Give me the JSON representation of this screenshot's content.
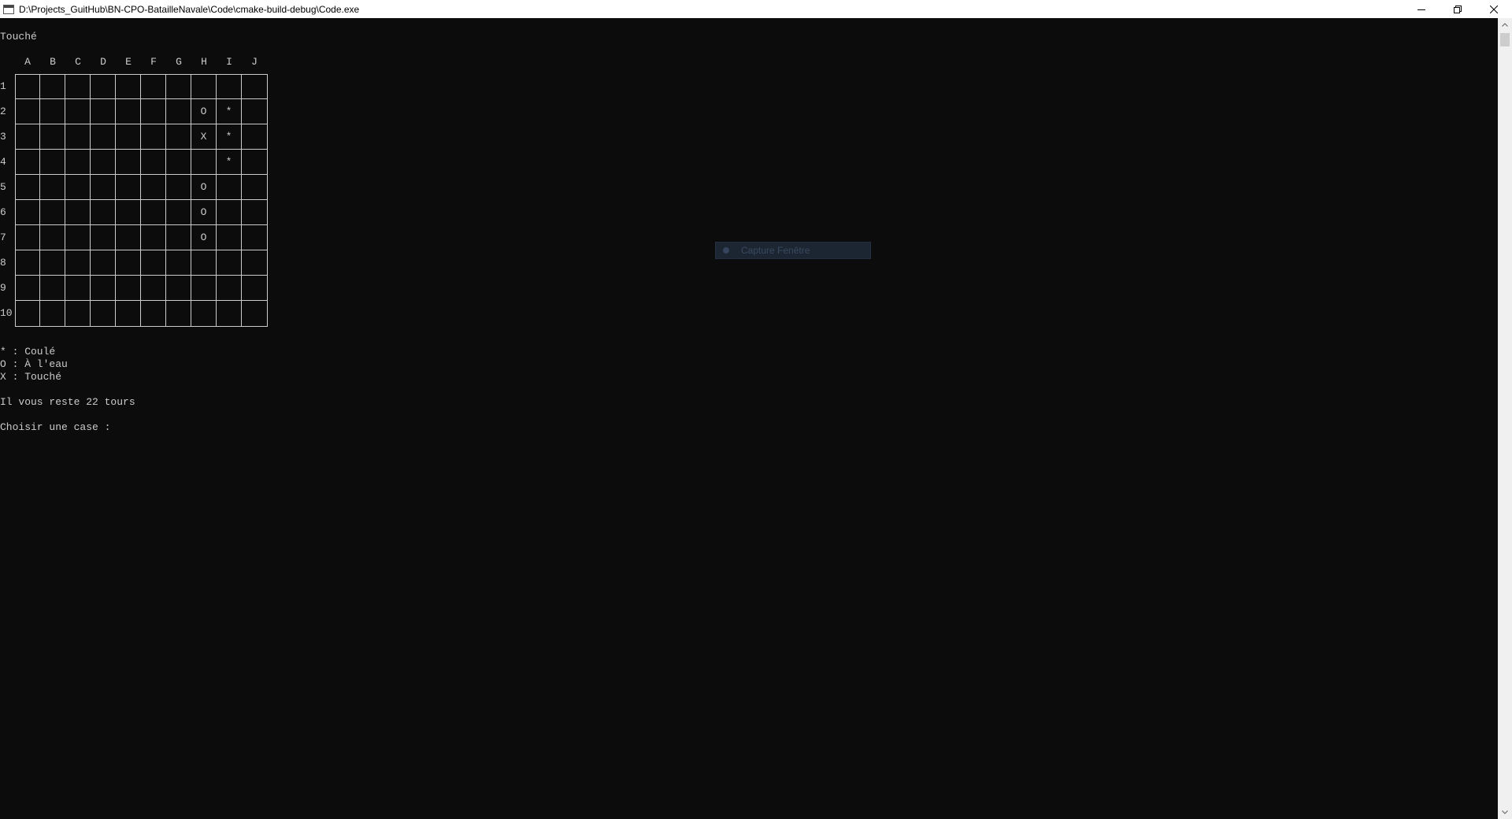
{
  "window": {
    "title": "D:\\Projects_GuitHub\\BN-CPO-BatailleNavale\\Code\\cmake-build-debug\\Code.exe",
    "minimize_icon": "minimize-icon",
    "restore_icon": "restore-icon",
    "close_icon": "close-icon"
  },
  "console": {
    "status_message": "Touché",
    "board": {
      "columns": [
        "A",
        "B",
        "C",
        "D",
        "E",
        "F",
        "G",
        "H",
        "I",
        "J"
      ],
      "rows": [
        "1",
        "2",
        "3",
        "4",
        "5",
        "6",
        "7",
        "8",
        "9",
        "10"
      ],
      "cells": [
        [
          "",
          "",
          "",
          "",
          "",
          "",
          "",
          "",
          "",
          ""
        ],
        [
          "",
          "",
          "",
          "",
          "",
          "",
          "",
          "O",
          "*",
          ""
        ],
        [
          "",
          "",
          "",
          "",
          "",
          "",
          "",
          "X",
          "*",
          ""
        ],
        [
          "",
          "",
          "",
          "",
          "",
          "",
          "",
          "",
          "*",
          ""
        ],
        [
          "",
          "",
          "",
          "",
          "",
          "",
          "",
          "O",
          "",
          ""
        ],
        [
          "",
          "",
          "",
          "",
          "",
          "",
          "",
          "O",
          "",
          ""
        ],
        [
          "",
          "",
          "",
          "",
          "",
          "",
          "",
          "O",
          "",
          ""
        ],
        [
          "",
          "",
          "",
          "",
          "",
          "",
          "",
          "",
          "",
          ""
        ],
        [
          "",
          "",
          "",
          "",
          "",
          "",
          "",
          "",
          "",
          ""
        ],
        [
          "",
          "",
          "",
          "",
          "",
          "",
          "",
          "",
          "",
          ""
        ]
      ]
    },
    "legend": {
      "sunk": "* : Coulé",
      "water": "O : À l'eau",
      "hit": "X : Touché"
    },
    "turns_remaining": "Il vous reste 22 tours",
    "prompt": "Choisir une case :"
  },
  "capture_tooltip": {
    "label": "Capture Fenêtre"
  }
}
